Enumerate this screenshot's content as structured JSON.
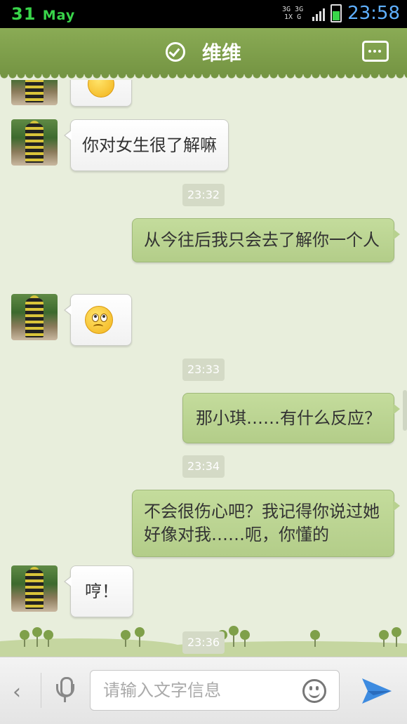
{
  "status_bar": {
    "date_day": "31",
    "date_month": "May",
    "net_top": "3G 3G 1X G",
    "time": "23:58",
    "accent_date_color": "#39d54a",
    "accent_time_color": "#5fb0ff"
  },
  "header": {
    "title": "维维",
    "header_color": "#7fa04a"
  },
  "messages": [
    {
      "side": "left",
      "type": "text",
      "text": "你对女生很了解嘛"
    },
    {
      "side": "center",
      "type": "timestamp",
      "text": "23:32"
    },
    {
      "side": "right",
      "type": "text",
      "text": "从今往后我只会去了解你一个人"
    },
    {
      "side": "left",
      "type": "emoji",
      "emoji": "thinking-emoji"
    },
    {
      "side": "center",
      "type": "timestamp",
      "text": "23:33"
    },
    {
      "side": "right",
      "type": "text",
      "text": "那小琪……有什么反应？"
    },
    {
      "side": "center",
      "type": "timestamp",
      "text": "23:34"
    },
    {
      "side": "right",
      "type": "text",
      "text": "不会很伤心吧？我记得你说过她好像对我……呃，你懂的"
    },
    {
      "side": "left",
      "type": "text",
      "text": "哼！"
    },
    {
      "side": "center",
      "type": "timestamp",
      "text": "23:36"
    }
  ],
  "input": {
    "placeholder": "请输入文字信息",
    "back_icon": "chevron-left-icon",
    "voice_icon": "microphone-icon",
    "emoji_icon": "smiley-icon",
    "send_icon": "send-icon"
  }
}
